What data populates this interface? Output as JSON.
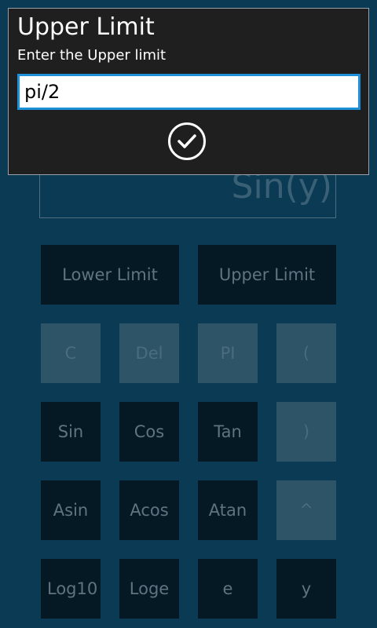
{
  "background": {
    "expression": "Sin(y)"
  },
  "dialog": {
    "title": "Upper Limit",
    "subtitle": "Enter the Upper limit",
    "input_value": "pi/2",
    "confirm_icon": "checkmark-circle-icon"
  },
  "buttons": {
    "lower_limit": "Lower Limit",
    "upper_limit": "Upper Limit",
    "clear": "C",
    "del": "Del",
    "pi": "PI",
    "open_paren": "(",
    "sin": "Sin",
    "cos": "Cos",
    "tan": "Tan",
    "close_paren": ")",
    "asin": "Asin",
    "acos": "Acos",
    "atan": "Atan",
    "power": "^",
    "log10": "Log10",
    "loge": "Loge",
    "e": "e",
    "y": "y"
  },
  "colors": {
    "accent": "#1e90d8",
    "background": "#0b3a54",
    "dialog": "#1f1f1f"
  }
}
